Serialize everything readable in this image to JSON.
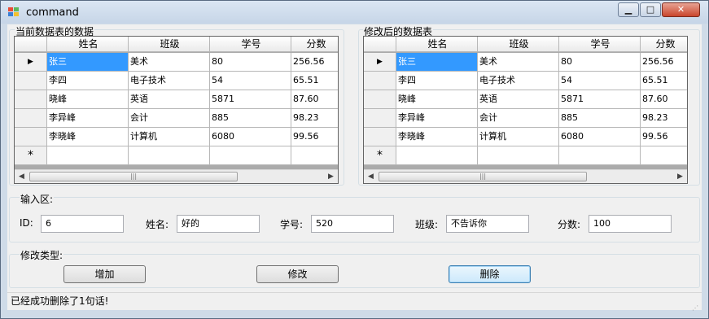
{
  "window": {
    "title": "command",
    "minimize_icon": "minimize-icon",
    "maximize_icon": "maximize-icon",
    "close_icon": "close-icon"
  },
  "left_grid": {
    "label": "当前数据表的数据",
    "columns": [
      "姓名",
      "班级",
      "学号",
      "分数"
    ],
    "rows": [
      [
        "张三",
        "美术",
        "80",
        "256.56"
      ],
      [
        "李四",
        "电子技术",
        "54",
        "65.51"
      ],
      [
        "晓峰",
        "英语",
        "5871",
        "87.60"
      ],
      [
        "李异峰",
        "会计",
        "885",
        "98.23"
      ],
      [
        "李晓峰",
        "计算机",
        "6080",
        "99.56"
      ]
    ],
    "current_row_marker": "▶",
    "new_row_marker": "*"
  },
  "right_grid": {
    "label": "修改后的数据表",
    "columns": [
      "姓名",
      "班级",
      "学号",
      "分数"
    ],
    "rows": [
      [
        "张三",
        "美术",
        "80",
        "256.56"
      ],
      [
        "李四",
        "电子技术",
        "54",
        "65.51"
      ],
      [
        "晓峰",
        "英语",
        "5871",
        "87.60"
      ],
      [
        "李异峰",
        "会计",
        "885",
        "98.23"
      ],
      [
        "李晓峰",
        "计算机",
        "6080",
        "99.56"
      ]
    ],
    "current_row_marker": "▶",
    "new_row_marker": "*"
  },
  "input_area": {
    "label": "输入区:",
    "id_label": "ID:",
    "id_value": "6",
    "name_label": "姓名:",
    "name_value": "好的",
    "number_label": "学号:",
    "number_value": "520",
    "class_label": "班级:",
    "class_value": "不告诉你",
    "score_label": "分数:",
    "score_value": "100"
  },
  "modify_area": {
    "label": "修改类型:",
    "add_label": "增加",
    "edit_label": "修改",
    "delete_label": "删除"
  },
  "status": {
    "text": "已经成功删除了1句话!"
  }
}
